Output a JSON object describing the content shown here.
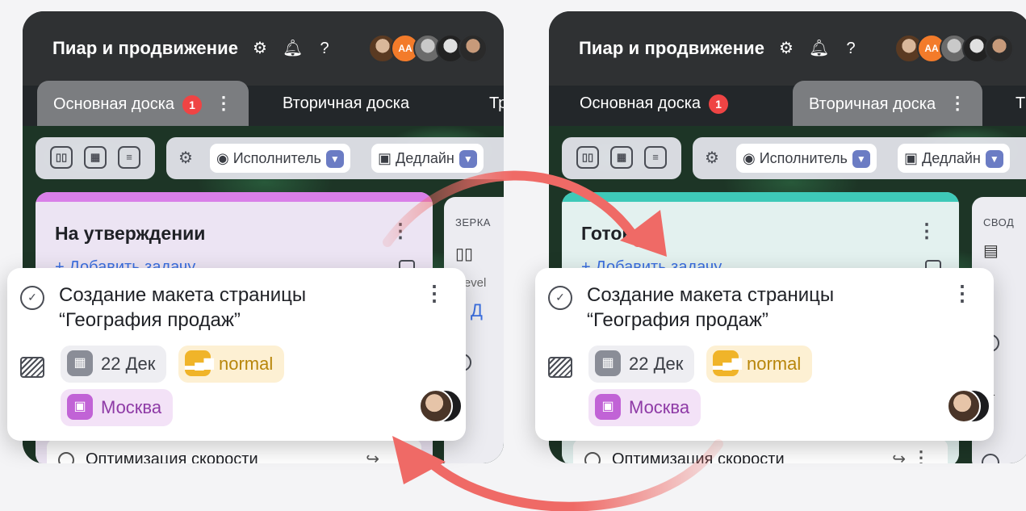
{
  "panels": [
    {
      "app_title": "Пиар и продвижение",
      "tabs": [
        {
          "label": "Основная доска",
          "badge": "1",
          "active": true
        },
        {
          "label": "Вторичная доска",
          "active": false
        },
        {
          "label": "Тр",
          "active": false
        }
      ],
      "filters": {
        "assignee": "Исполнитель",
        "deadline": "Дедлайн"
      },
      "column": {
        "title": "На утверждении",
        "add_task": "+ Добавить задачу",
        "accent": "#d97fe8"
      },
      "side_column": {
        "label": "ЗЕРКА",
        "line2": "Devel",
        "line3": "+ Д"
      },
      "under_task": "Оптимизация скорости"
    },
    {
      "app_title": "Пиар и продвижение",
      "tabs": [
        {
          "label": "Основная доска",
          "badge": "1",
          "active": false
        },
        {
          "label": "Вторичная доска",
          "active": true
        },
        {
          "label": "Т",
          "active": false
        }
      ],
      "filters": {
        "assignee": "Исполнитель",
        "deadline": "Дедлайн"
      },
      "column": {
        "title": "Готово",
        "add_task": "+ Добавить задачу",
        "accent": "#3ec9b8"
      },
      "side_column": {
        "label": "СВОД"
      },
      "under_task": "Оптимизация скорости"
    }
  ],
  "avatar_initials": "AA",
  "task_card": {
    "title": "Создание макета страницы “География продаж”",
    "date": "22 Дек",
    "priority": "normal",
    "city": "Москва"
  },
  "icons": [
    "settings-icon",
    "bell-icon",
    "help-icon",
    "kanban-view-icon",
    "calendar-view-icon",
    "list-view-icon",
    "filter-funnel-icon",
    "check-circle-icon",
    "board-icon",
    "calendar-icon",
    "priority-bars-icon",
    "image-icon",
    "swap-arrows-icon"
  ],
  "colors": {
    "swap_arrow": "#ef6a66",
    "badge": "#ef4444",
    "link": "#3b6fe0"
  }
}
